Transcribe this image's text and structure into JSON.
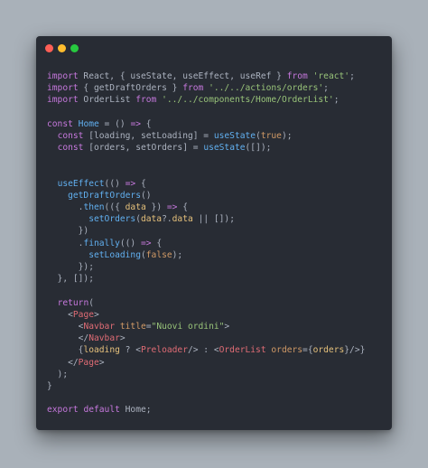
{
  "window": {
    "colors": {
      "background": "#a9b1b9",
      "editor_bg": "#282c34",
      "dot_red": "#ff5f56",
      "dot_yellow": "#ffbd2e",
      "dot_green": "#27c93f"
    },
    "traffic_lights": [
      "close",
      "minimize",
      "maximize"
    ]
  },
  "code": {
    "lines": [
      [
        {
          "t": "import",
          "k": "keyword"
        },
        {
          "t": " React, { ",
          "k": "plain"
        },
        {
          "t": "useState",
          "k": "plain"
        },
        {
          "t": ", ",
          "k": "plain"
        },
        {
          "t": "useEffect",
          "k": "plain"
        },
        {
          "t": ", ",
          "k": "plain"
        },
        {
          "t": "useRef",
          "k": "plain"
        },
        {
          "t": " } ",
          "k": "plain"
        },
        {
          "t": "from",
          "k": "keyword"
        },
        {
          "t": " ",
          "k": "plain"
        },
        {
          "t": "'react'",
          "k": "string"
        },
        {
          "t": ";",
          "k": "plain"
        }
      ],
      [
        {
          "t": "import",
          "k": "keyword"
        },
        {
          "t": " { getDraftOrders } ",
          "k": "plain"
        },
        {
          "t": "from",
          "k": "keyword"
        },
        {
          "t": " ",
          "k": "plain"
        },
        {
          "t": "'../../actions/orders'",
          "k": "string"
        },
        {
          "t": ";",
          "k": "plain"
        }
      ],
      [
        {
          "t": "import",
          "k": "keyword"
        },
        {
          "t": " OrderList ",
          "k": "plain"
        },
        {
          "t": "from",
          "k": "keyword"
        },
        {
          "t": " ",
          "k": "plain"
        },
        {
          "t": "'../../components/Home/OrderList'",
          "k": "string"
        },
        {
          "t": ";",
          "k": "plain"
        }
      ],
      [],
      [
        {
          "t": "const",
          "k": "keyword"
        },
        {
          "t": " ",
          "k": "plain"
        },
        {
          "t": "Home",
          "k": "func"
        },
        {
          "t": " = () ",
          "k": "plain"
        },
        {
          "t": "=>",
          "k": "keyword"
        },
        {
          "t": " {",
          "k": "plain"
        }
      ],
      [
        {
          "t": "  ",
          "k": "plain"
        },
        {
          "t": "const",
          "k": "keyword"
        },
        {
          "t": " [loading, setLoading] = ",
          "k": "plain"
        },
        {
          "t": "useState",
          "k": "func"
        },
        {
          "t": "(",
          "k": "plain"
        },
        {
          "t": "true",
          "k": "const"
        },
        {
          "t": ");",
          "k": "plain"
        }
      ],
      [
        {
          "t": "  ",
          "k": "plain"
        },
        {
          "t": "const",
          "k": "keyword"
        },
        {
          "t": " [orders, setOrders] = ",
          "k": "plain"
        },
        {
          "t": "useState",
          "k": "func"
        },
        {
          "t": "([]);",
          "k": "plain"
        }
      ],
      [],
      [],
      [
        {
          "t": "  ",
          "k": "plain"
        },
        {
          "t": "useEffect",
          "k": "func"
        },
        {
          "t": "(() ",
          "k": "plain"
        },
        {
          "t": "=>",
          "k": "keyword"
        },
        {
          "t": " {",
          "k": "plain"
        }
      ],
      [
        {
          "t": "    ",
          "k": "plain"
        },
        {
          "t": "getDraftOrders",
          "k": "func"
        },
        {
          "t": "()",
          "k": "plain"
        }
      ],
      [
        {
          "t": "      .",
          "k": "plain"
        },
        {
          "t": "then",
          "k": "func"
        },
        {
          "t": "(({ ",
          "k": "plain"
        },
        {
          "t": "data",
          "k": "var"
        },
        {
          "t": " }) ",
          "k": "plain"
        },
        {
          "t": "=>",
          "k": "keyword"
        },
        {
          "t": " {",
          "k": "plain"
        }
      ],
      [
        {
          "t": "        ",
          "k": "plain"
        },
        {
          "t": "setOrders",
          "k": "func"
        },
        {
          "t": "(",
          "k": "plain"
        },
        {
          "t": "data",
          "k": "var"
        },
        {
          "t": "?.",
          "k": "plain"
        },
        {
          "t": "data",
          "k": "var"
        },
        {
          "t": " || []);",
          "k": "plain"
        }
      ],
      [
        {
          "t": "      })",
          "k": "plain"
        }
      ],
      [
        {
          "t": "      .",
          "k": "plain"
        },
        {
          "t": "finally",
          "k": "func"
        },
        {
          "t": "(() ",
          "k": "plain"
        },
        {
          "t": "=>",
          "k": "keyword"
        },
        {
          "t": " {",
          "k": "plain"
        }
      ],
      [
        {
          "t": "        ",
          "k": "plain"
        },
        {
          "t": "setLoading",
          "k": "func"
        },
        {
          "t": "(",
          "k": "plain"
        },
        {
          "t": "false",
          "k": "const"
        },
        {
          "t": ");",
          "k": "plain"
        }
      ],
      [
        {
          "t": "      });",
          "k": "plain"
        }
      ],
      [
        {
          "t": "  }, []);",
          "k": "plain"
        }
      ],
      [],
      [
        {
          "t": "  ",
          "k": "plain"
        },
        {
          "t": "return",
          "k": "keyword"
        },
        {
          "t": "(",
          "k": "plain"
        }
      ],
      [
        {
          "t": "    <",
          "k": "plain"
        },
        {
          "t": "Page",
          "k": "tag"
        },
        {
          "t": ">",
          "k": "plain"
        }
      ],
      [
        {
          "t": "      <",
          "k": "plain"
        },
        {
          "t": "Navbar",
          "k": "tag"
        },
        {
          "t": " ",
          "k": "plain"
        },
        {
          "t": "title",
          "k": "attr"
        },
        {
          "t": "=",
          "k": "plain"
        },
        {
          "t": "\"Nuovi ordini\"",
          "k": "string"
        },
        {
          "t": ">",
          "k": "plain"
        }
      ],
      [
        {
          "t": "      </",
          "k": "plain"
        },
        {
          "t": "Navbar",
          "k": "tag"
        },
        {
          "t": ">",
          "k": "plain"
        }
      ],
      [
        {
          "t": "      {",
          "k": "plain"
        },
        {
          "t": "loading",
          "k": "var"
        },
        {
          "t": " ? <",
          "k": "plain"
        },
        {
          "t": "Preloader",
          "k": "tag"
        },
        {
          "t": "/> : <",
          "k": "plain"
        },
        {
          "t": "OrderList",
          "k": "tag"
        },
        {
          "t": " ",
          "k": "plain"
        },
        {
          "t": "orders",
          "k": "attr"
        },
        {
          "t": "={",
          "k": "plain"
        },
        {
          "t": "orders",
          "k": "var"
        },
        {
          "t": "}/>}",
          "k": "plain"
        }
      ],
      [
        {
          "t": "    </",
          "k": "plain"
        },
        {
          "t": "Page",
          "k": "tag"
        },
        {
          "t": ">",
          "k": "plain"
        }
      ],
      [
        {
          "t": "  );",
          "k": "plain"
        }
      ],
      [
        {
          "t": "}",
          "k": "plain"
        }
      ],
      [],
      [
        {
          "t": "export",
          "k": "keyword"
        },
        {
          "t": " ",
          "k": "plain"
        },
        {
          "t": "default",
          "k": "keyword"
        },
        {
          "t": " Home;",
          "k": "plain"
        }
      ]
    ]
  }
}
